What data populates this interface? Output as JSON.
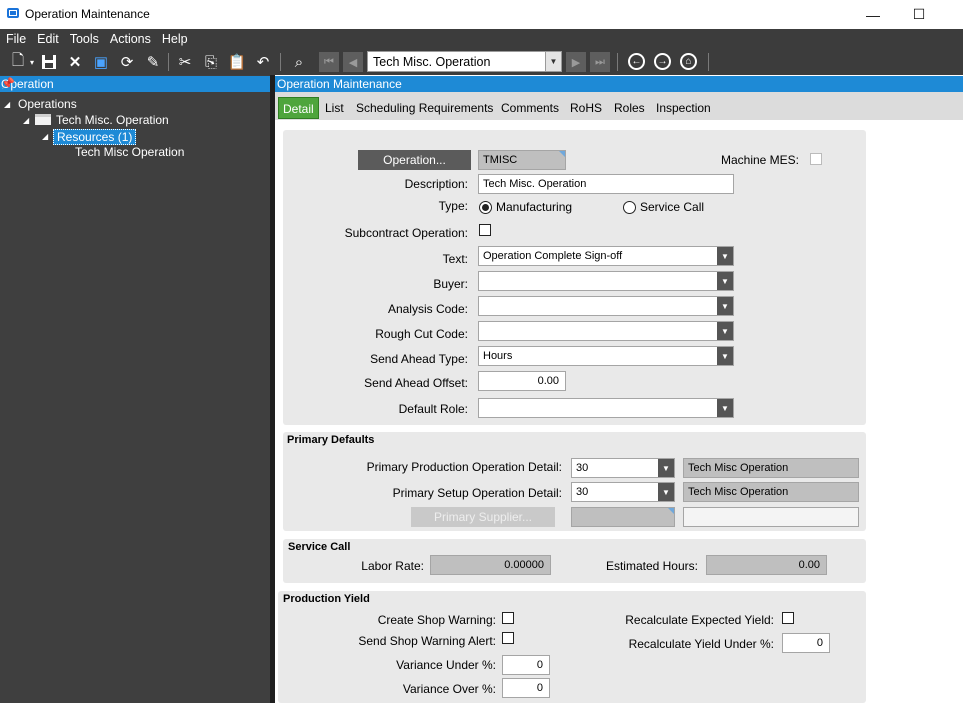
{
  "window": {
    "title": "Operation Maintenance",
    "minimize": "—",
    "maximize": "☐"
  },
  "menu": [
    "File",
    "Edit",
    "Tools",
    "Actions",
    "Help"
  ],
  "toolbar": {
    "nav_value": "Tech Misc. Operation"
  },
  "left_panel": {
    "header": "Operation",
    "tree": {
      "root": "Operations",
      "child": "Tech Misc. Operation",
      "resources": "Resources (1)",
      "leaf": "Tech Misc Operation"
    }
  },
  "right_panel": {
    "header": "Operation Maintenance",
    "tabs": [
      "Detail",
      "List",
      "Scheduling Requirements",
      "Comments",
      "RoHS",
      "Roles",
      "Inspection"
    ],
    "active_tab": "Detail"
  },
  "form": {
    "operation_button": "Operation...",
    "operation_value": "TMISC",
    "machine_mes_label": "Machine MES:",
    "description_label": "Description:",
    "description_value": "Tech Misc. Operation",
    "type_label": "Type:",
    "type_manufacturing": "Manufacturing",
    "type_service_call": "Service Call",
    "type_selected": "Manufacturing",
    "subcontract_label": "Subcontract Operation:",
    "text_label": "Text:",
    "text_value": "Operation Complete Sign-off",
    "buyer_label": "Buyer:",
    "buyer_value": "",
    "analysis_label": "Analysis Code:",
    "analysis_value": "",
    "roughcut_label": "Rough Cut Code:",
    "roughcut_value": "",
    "sendahead_type_label": "Send Ahead Type:",
    "sendahead_type_value": "Hours",
    "sendahead_offset_label": "Send Ahead Offset:",
    "sendahead_offset_value": "0.00",
    "default_role_label": "Default Role:",
    "default_role_value": ""
  },
  "primary_defaults": {
    "title": "Primary Defaults",
    "prod_label": "Primary Production Operation Detail:",
    "prod_value": "30",
    "prod_desc": "Tech Misc Operation",
    "setup_label": "Primary Setup Operation Detail:",
    "setup_value": "30",
    "setup_desc": "Tech Misc Operation",
    "supplier_button": "Primary Supplier...",
    "supplier_id": "",
    "supplier_name": ""
  },
  "service_call": {
    "title": "Service Call",
    "labor_rate_label": "Labor Rate:",
    "labor_rate_value": "0.00000",
    "est_hours_label": "Estimated Hours:",
    "est_hours_value": "0.00"
  },
  "production_yield": {
    "title": "Production Yield",
    "create_warning_label": "Create Shop Warning:",
    "send_alert_label": "Send Shop Warning Alert:",
    "variance_under_label": "Variance Under %:",
    "variance_under_value": "0",
    "variance_over_label": "Variance Over %:",
    "variance_over_value": "0",
    "recalc_label": "Recalculate Expected Yield:",
    "recalc_under_label": "Recalculate Yield Under %:",
    "recalc_under_value": "0"
  }
}
